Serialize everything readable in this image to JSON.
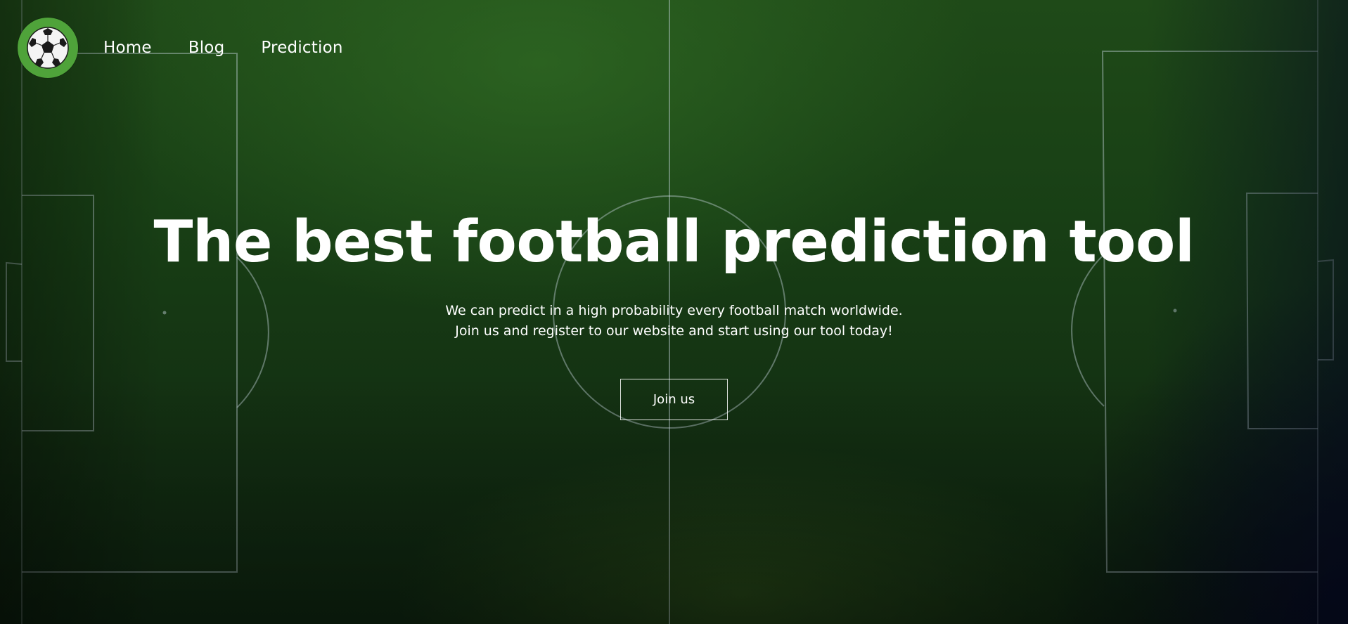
{
  "nav": {
    "logo_icon": "soccer-ball-icon",
    "items": [
      {
        "label": "Home"
      },
      {
        "label": "Blog"
      },
      {
        "label": "Prediction"
      }
    ]
  },
  "hero": {
    "title": "The best football prediction tool",
    "subtitle_line1": "We can predict in a high probability every football match worldwide.",
    "subtitle_line2": "Join us and register to our website and start using our tool today!",
    "cta_label": "Join us"
  },
  "colors": {
    "pitch_green": "#1f4a18",
    "logo_green": "#4fa33a",
    "text": "#ffffff",
    "pitch_lines": "#c8d7e1"
  }
}
